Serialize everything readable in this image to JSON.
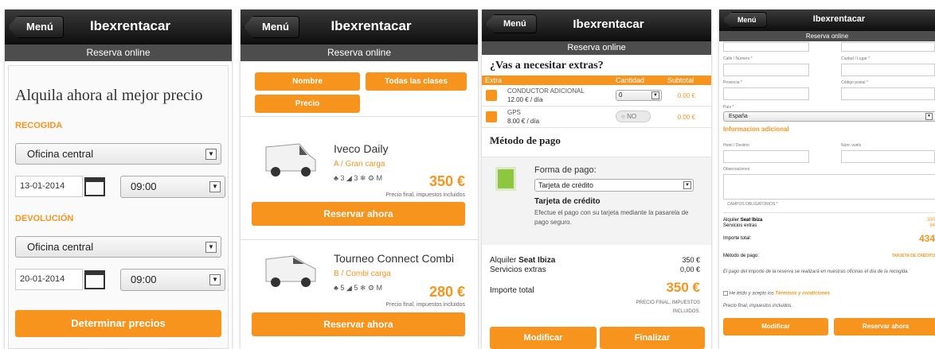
{
  "common": {
    "menu": "Menú",
    "brand": "Ibexrentacar",
    "subtitle": "Reserva online"
  },
  "s1": {
    "title": "Alquila ahora al mejor precio",
    "pickup_label": "RECOGIDA",
    "pickup_office": "Oficina central",
    "pickup_date": "13-01-2014",
    "pickup_time": "09:00",
    "return_label": "DEVOLUCIÓN",
    "return_office": "Oficina central",
    "return_date": "20-01-2014",
    "return_time": "09:00",
    "submit": "Determinar precios"
  },
  "s2": {
    "filters": [
      "Nombre",
      "Todas las clases",
      "Precio"
    ],
    "cars": [
      {
        "name": "Iveco Daily",
        "class": "A / Gran carga",
        "specs": "♣ 3  ◢ 3  ❄  ⚙ M",
        "price": "350 €",
        "note": "Precio final, impuestos incluidos",
        "reserve": "Reservar ahora"
      },
      {
        "name": "Tourneo Connect Combi",
        "class": "B / Combi carga",
        "specs": "♣ 5  ◢ 5  ❄  ⚙ M",
        "price": "280 €",
        "note": "Precio final, impuestos incluidos",
        "reserve": "Reservar ahora"
      }
    ]
  },
  "s3": {
    "extras_title": "¿Vas a necesitar extras?",
    "headers": [
      "Extra",
      "Cantidad",
      "Subtotal"
    ],
    "extras": [
      {
        "name": "CONDUCTOR ADICIONAL",
        "price": "12.00 € / día",
        "qty": "0",
        "subtotal": "0.00 €"
      },
      {
        "name": "GPS",
        "price": "8.00 € / día",
        "qty": "NO",
        "subtotal": "0.00 €"
      }
    ],
    "payment_title": "Método de pago",
    "pay_form_label": "Forma de pago:",
    "pay_form_value": "Tarjeta de crédito",
    "card_title": "Tarjeta de crédito",
    "card_desc": "Efectue el pago con su tarjeta mediante la pasarela de pago seguro.",
    "rental_label": "Alquiler",
    "rental_car": "Seat Ibiza",
    "rental_value": "350 €",
    "extras_label": "Servicios extras",
    "extras_value": "0,00 €",
    "total_label": "Importe total",
    "total_value": "350 €",
    "total_note": "PRECIO FINAL, IMPUESTOS INCLUIDOS.",
    "btn_modify": "Modificar",
    "btn_finish": "Finalizar"
  },
  "s4": {
    "street_label": "Calle / Número *",
    "city_label": "Ciudad / Lugar *",
    "province_label": "Provincia *",
    "zip_label": "Código postal *",
    "country_label": "País *",
    "country_value": "España",
    "info_title": "Informacion adicional",
    "hotel_label": "Hotel / Destino",
    "flight_label": "Núm. vuelo",
    "notes_label": "Observaciones",
    "required_note": "CAMPOS OBLIGATORIOS *",
    "rental_label": "Alquiler",
    "rental_car": "Seat Ibiza",
    "rental_value": "350",
    "extras_label": "Servicios extras",
    "extras_value": "84",
    "total_label": "Importe total:",
    "total_value": "434",
    "method_label": "Método de pago:",
    "method_value": "TARJETA DE CRÉDITO",
    "pay_note": "El pago del importe de la reserva se realizará en nuestras oficinas el día de la recogida.",
    "terms_pre": "He leído y acepto los",
    "terms_link": "Términos y condiciones",
    "final_note": "Precio final, impuestos incluidos.",
    "btn_modify": "Modificar",
    "btn_reserve": "Reservar ahora"
  }
}
